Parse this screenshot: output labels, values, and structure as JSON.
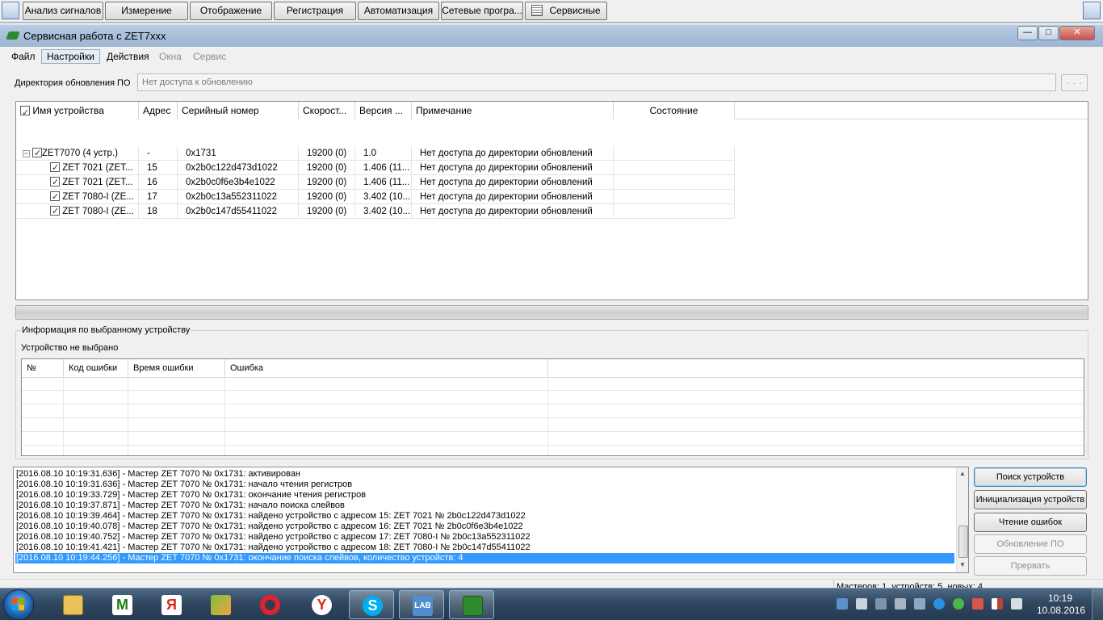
{
  "topbar": {
    "buttons": [
      "Анализ сигналов",
      "Измерение",
      "Отображение",
      "Регистрация",
      "Автоматизация",
      "Сетевые програ...",
      "Сервисные"
    ]
  },
  "window": {
    "title": "Сервисная работа с ZET7xxx",
    "controls": {
      "minimize": "—",
      "maximize": "□",
      "close": "✕"
    }
  },
  "menu": {
    "items": [
      "Файл",
      "Настройки",
      "Действия",
      "Окна",
      "Сервис"
    ],
    "active": "Настройки",
    "disabled": [
      "Окна",
      "Сервис"
    ]
  },
  "update_dir": {
    "label": "Директория обновления ПО",
    "value": "Нет доступа к обновлению",
    "browse": ". . ."
  },
  "device_grid": {
    "columns": [
      "Имя устройства",
      "Адрес",
      "Серийный номер",
      "Скорост...",
      "Версия ...",
      "Примечание",
      "Состояние"
    ],
    "rows": [
      {
        "name": "ZET7070 (4 устр.)",
        "address": "-",
        "serial": "0x1731",
        "speed": "19200 (0)",
        "version": "1.0",
        "note": "Нет доступа до директории обновлений",
        "state": ""
      },
      {
        "name": "ZET 7021 (ZET...",
        "address": "15",
        "serial": "0x2b0c122d473d1022",
        "speed": "19200 (0)",
        "version": "1.406 (11...",
        "note": "Нет доступа до директории обновлений",
        "state": ""
      },
      {
        "name": "ZET 7021 (ZET...",
        "address": "16",
        "serial": "0x2b0c0f6e3b4e1022",
        "speed": "19200 (0)",
        "version": "1.406 (11...",
        "note": "Нет доступа до директории обновлений",
        "state": ""
      },
      {
        "name": "ZET 7080-I (ZE...",
        "address": "17",
        "serial": "0x2b0c13a552311022",
        "speed": "19200 (0)",
        "version": "3.402 (10...",
        "note": "Нет доступа до директории обновлений",
        "state": ""
      },
      {
        "name": "ZET 7080-I (ZE...",
        "address": "18",
        "serial": "0x2b0c147d55411022",
        "speed": "19200 (0)",
        "version": "3.402 (10...",
        "note": "Нет доступа до директории обновлений",
        "state": ""
      }
    ]
  },
  "info": {
    "title": "Информация по выбранному устройству",
    "device": "Устройство не выбрано",
    "error_columns": [
      "№",
      "Код ошибки",
      "Время ошибки",
      "Ошибка"
    ]
  },
  "log": {
    "lines": [
      "[2016.08.10 10:19:31.636] - Мастер ZET 7070 № 0x1731: активирован",
      "[2016.08.10 10:19:31.636] - Мастер ZET 7070 № 0x1731: начало чтения регистров",
      "[2016.08.10 10:19:33.729] - Мастер ZET 7070 № 0x1731: окончание чтения регистров",
      "[2016.08.10 10:19:37.871] - Мастер ZET 7070 № 0x1731: начало поиска слейвов",
      "[2016.08.10 10:19:39.464] - Мастер ZET 7070 № 0x1731: найдено устройство с адресом 15: ZET 7021 № 2b0c122d473d1022",
      "[2016.08.10 10:19:40.078] - Мастер ZET 7070 № 0x1731: найдено устройство с адресом 16: ZET 7021 № 2b0c0f6e3b4e1022",
      "[2016.08.10 10:19:40.752] - Мастер ZET 7070 № 0x1731: найдено устройство с адресом 17: ZET 7080-I № 2b0c13a552311022",
      "[2016.08.10 10:19:41.421] - Мастер ZET 7070 № 0x1731: найдено устройство с адресом 18: ZET 7080-I № 2b0c147d55411022",
      "[2016.08.10 10:19:44.256] - Мастер ZET 7070 № 0x1731: окончание поиска слейвов, количество устройств: 4"
    ]
  },
  "actions": {
    "search": "Поиск устройств",
    "init": "Инициализация устройств",
    "read_errors": "Чтение ошибок",
    "update": "Обновление ПО",
    "abort": "Прервать"
  },
  "statusbar": {
    "text": "Мастеров: 1, устройств: 5, новых: 4"
  },
  "taskbar": {
    "clock_time": "10:19",
    "clock_date": "10.08.2016",
    "apps": [
      "file-explorer-icon",
      "mathcad-icon",
      "yandex-icon",
      "taskmanager-icon",
      "opera-icon",
      "yandex-browser-icon",
      "skype-icon",
      "zetlab-icon",
      "zet-module-icon"
    ]
  }
}
